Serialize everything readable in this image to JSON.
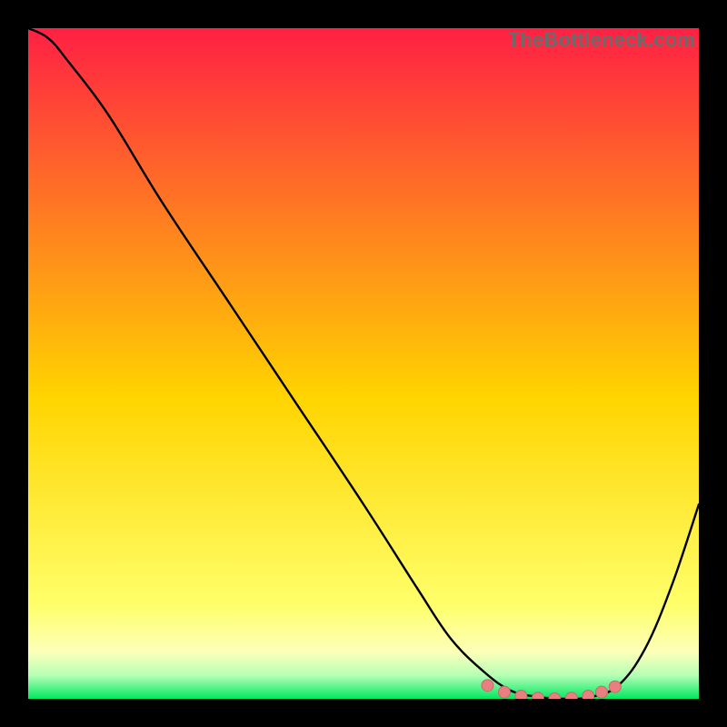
{
  "watermark": "TheBottleneck.com",
  "colors": {
    "top": "#ff2044",
    "mid": "#ffd400",
    "low": "#ffff6a",
    "band_top": "#fdffb8",
    "band_mid": "#b6ffb6",
    "bottom": "#00e860",
    "curve": "#000000",
    "marker_fill": "#e98080",
    "marker_stroke": "#c96a6a"
  },
  "chart_data": {
    "type": "line",
    "title": "",
    "xlabel": "",
    "ylabel": "",
    "xlim": [
      0,
      1
    ],
    "ylim": [
      0,
      1
    ],
    "series": [
      {
        "name": "curve",
        "x": [
          0.0,
          0.03,
          0.06,
          0.12,
          0.2,
          0.3,
          0.4,
          0.5,
          0.58,
          0.63,
          0.68,
          0.72,
          0.76,
          0.8,
          0.84,
          0.88,
          0.92,
          0.96,
          1.0
        ],
        "y": [
          1.0,
          0.985,
          0.95,
          0.87,
          0.74,
          0.59,
          0.44,
          0.29,
          0.165,
          0.09,
          0.04,
          0.012,
          0.003,
          0.0,
          0.003,
          0.02,
          0.075,
          0.17,
          0.29
        ]
      }
    ],
    "markers": {
      "name": "flat-region",
      "x": [
        0.685,
        0.71,
        0.735,
        0.76,
        0.785,
        0.81,
        0.835,
        0.855,
        0.875
      ],
      "y": [
        0.02,
        0.01,
        0.004,
        0.001,
        0.0,
        0.001,
        0.004,
        0.01,
        0.018
      ]
    }
  }
}
